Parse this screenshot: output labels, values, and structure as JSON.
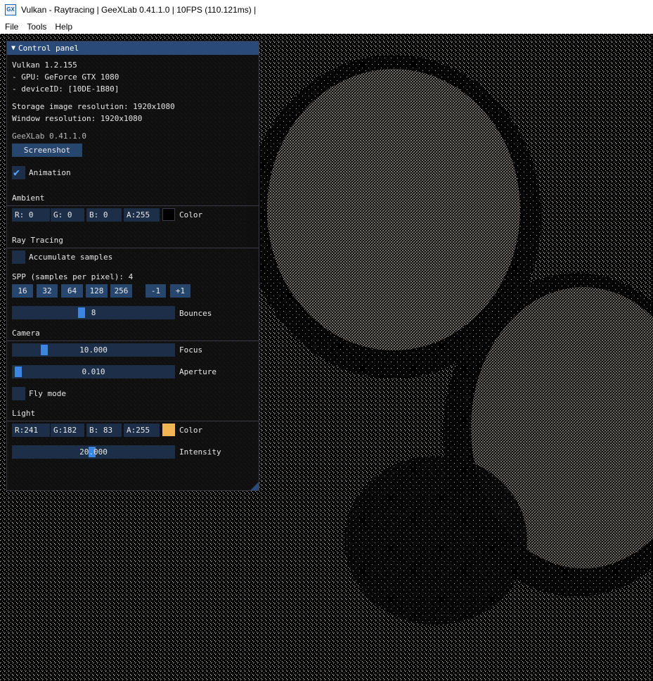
{
  "window": {
    "title": "Vulkan - Raytracing | GeeXLab 0.41.1.0 | 10FPS (110.121ms) |",
    "menu": [
      "File",
      "Tools",
      "Help"
    ]
  },
  "panel": {
    "title": "Control panel",
    "info": {
      "vulkan": "Vulkan 1.2.155",
      "gpu": "- GPU: GeForce GTX 1080",
      "device": "- deviceID: [10DE-1B80]",
      "storage_res": "Storage image resolution: 1920x1080",
      "window_res": "Window resolution: 1920x1080",
      "geexlab": "GeeXLab 0.41.1.0"
    },
    "screenshot_label": "Screenshot",
    "animation": {
      "label": "Animation",
      "checked": true
    },
    "ambient": {
      "header": "Ambient",
      "r": "R:  0",
      "g": "G:  0",
      "b": "B:  0",
      "a": "A:255",
      "color_label": "Color",
      "swatch": "#000000"
    },
    "raytracing": {
      "header": "Ray Tracing",
      "accumulate": {
        "label": "Accumulate samples",
        "checked": false
      },
      "spp_label": "SPP (samples per pixel): 4",
      "spp_buttons": [
        "16",
        "32",
        "64",
        "128",
        "256"
      ],
      "minus": "-1",
      "plus": "+1",
      "bounces": {
        "value": "8",
        "label": "Bounces",
        "fraction": 0.42
      }
    },
    "camera": {
      "header": "Camera",
      "focus": {
        "value": "10.000",
        "label": "Focus",
        "fraction": 0.18
      },
      "aperture": {
        "value": "0.010",
        "label": "Aperture",
        "fraction": 0.01
      },
      "fly_mode": {
        "label": "Fly mode",
        "checked": false
      }
    },
    "light": {
      "header": "Light",
      "r": "R:241",
      "g": "G:182",
      "b": "B: 83",
      "a": "A:255",
      "color_label": "Color",
      "swatch": "#f1b653",
      "intensity": {
        "value": "20.000",
        "label": "Intensity",
        "fraction": 0.49
      }
    }
  },
  "colors": {
    "header_blue": "#2a4a7a",
    "button_blue": "#26466e",
    "field_blue": "#1d2f48",
    "grab_blue": "#3d85e0",
    "accent_check": "#5aa8ff"
  }
}
